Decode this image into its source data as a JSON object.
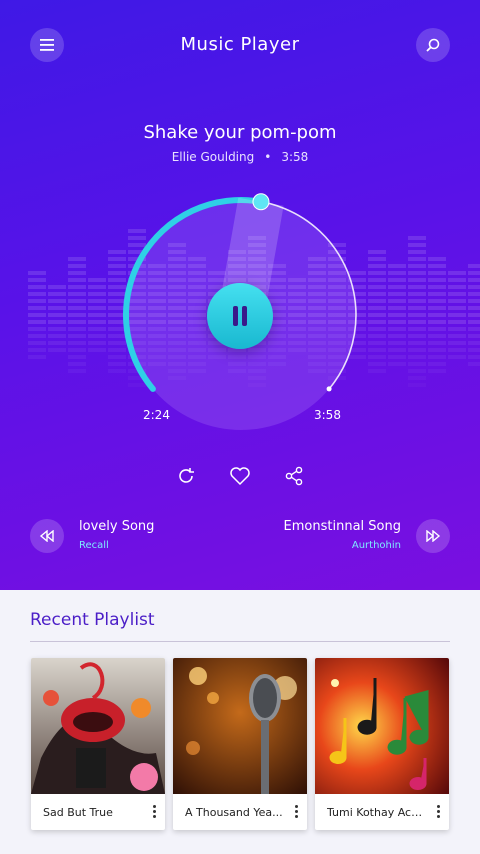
{
  "header": {
    "title": "Music Player",
    "menu_icon": "menu-icon",
    "search_icon": "search-icon"
  },
  "now_playing": {
    "title": "Shake your pom-pom",
    "artist": "Ellie Goulding",
    "separator": "•",
    "duration": "3:58",
    "elapsed": "2:24",
    "total": "3:58",
    "progress": 0.6,
    "state_icon": "pause-icon"
  },
  "actions": {
    "repeat_icon": "repeat-icon",
    "like_icon": "heart-icon",
    "share_icon": "share-icon"
  },
  "previous_track": {
    "title": "lovely Song",
    "artist": "Recall",
    "icon": "rewind-icon"
  },
  "next_track": {
    "title": "Emonstinnal Song",
    "artist": "Aurthohin",
    "icon": "fast-forward-icon"
  },
  "playlist": {
    "heading": "Recent Playlist",
    "items": [
      {
        "title": "Sad But True"
      },
      {
        "title": "A Thousand Yea..."
      },
      {
        "title": "Tumi Kothay Ach..."
      }
    ]
  },
  "colors": {
    "accent": "#2fd0e6",
    "background_top": "#3f19e6",
    "background_bottom": "#7a0fe0",
    "heading": "#4b1ec7"
  }
}
